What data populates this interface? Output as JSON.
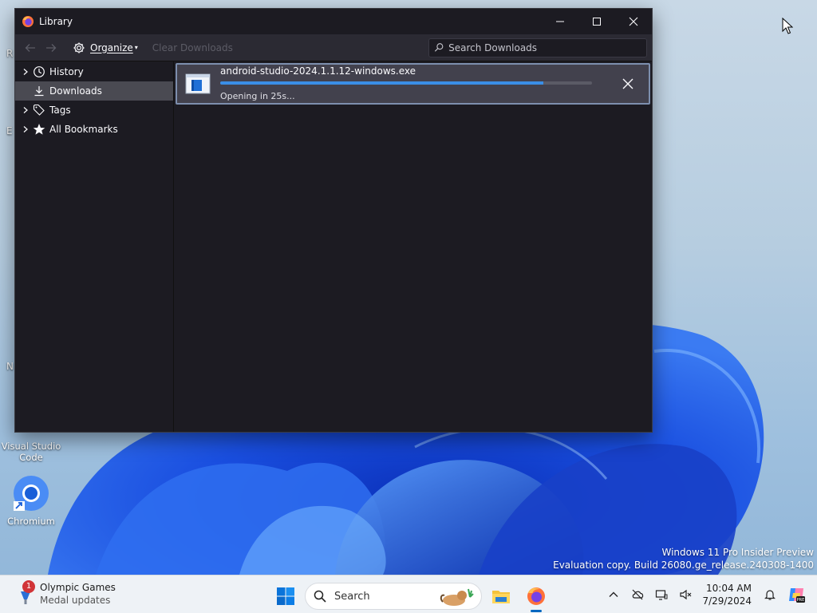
{
  "desktop": {
    "icons": [
      {
        "label_line1": "Visual Studio",
        "label_line2": "Code"
      },
      {
        "label_line1": "Chromium",
        "label_line2": ""
      }
    ],
    "edge_fragments": [
      "R",
      "E",
      "N"
    ],
    "watermark": {
      "line1": "Windows 11 Pro Insider Preview",
      "line2": "Evaluation copy. Build 26080.ge_release.240308-1400"
    }
  },
  "window": {
    "title": "Library",
    "controls": [
      "minimize-icon",
      "maximize-icon",
      "close-icon"
    ],
    "toolbar": {
      "organize_label": "Organize",
      "clear_label": "Clear Downloads",
      "search_placeholder": "Search Downloads",
      "search_value": ""
    },
    "sidebar": {
      "items": [
        {
          "label": "History",
          "icon": "clock-icon",
          "expandable": true,
          "selected": false
        },
        {
          "label": "Downloads",
          "icon": "download-icon",
          "expandable": false,
          "selected": true
        },
        {
          "label": "Tags",
          "icon": "tag-icon",
          "expandable": true,
          "selected": false
        },
        {
          "label": "All Bookmarks",
          "icon": "star-icon",
          "expandable": true,
          "selected": false
        }
      ]
    },
    "downloads": [
      {
        "filename": "android-studio-2024.1.1.12-windows.exe",
        "status": "Opening in 25s...",
        "progress": 0.87
      }
    ]
  },
  "taskbar": {
    "widget": {
      "title": "Olympic Games",
      "subtitle": "Medal updates",
      "badge": "1"
    },
    "search_label": "Search",
    "apps": [
      "file-explorer-icon",
      "firefox-icon"
    ],
    "clock": {
      "time": "10:04 AM",
      "date": "7/29/2024"
    }
  },
  "colors": {
    "window_bg": "#1c1b22",
    "toolbar_bg": "#2b2a33",
    "selected_row": "#4a4a52",
    "download_item_bg": "#42414d",
    "progress_fill": "#3a8ee6",
    "taskbar_bg": "#eef2f6"
  }
}
